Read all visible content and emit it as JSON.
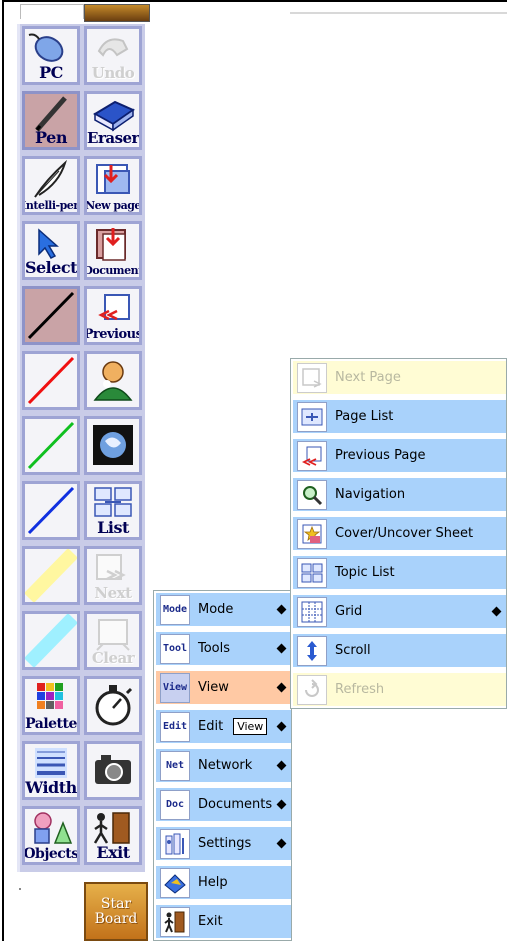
{
  "colors": {
    "toolbar_bg": "#c9cce8",
    "menu_item": "#a9d2fb",
    "menu_item_highlight": "#ffc9a4",
    "menu_item_disabled": "#fffcd4",
    "label_text": "#000054"
  },
  "toolbar": {
    "items": [
      {
        "label": "PC",
        "icon": "mouse-icon",
        "state": "normal"
      },
      {
        "label": "Undo",
        "icon": "undo-icon",
        "state": "disabled"
      },
      {
        "label": "Pen",
        "icon": "pen-icon",
        "state": "active"
      },
      {
        "label": "Eraser",
        "icon": "eraser-icon",
        "state": "normal"
      },
      {
        "label": "Intelli-pen",
        "icon": "quill-icon",
        "state": "normal"
      },
      {
        "label": "New page",
        "icon": "new-page-icon",
        "state": "normal"
      },
      {
        "label": "Select",
        "icon": "select-arrow-icon",
        "state": "normal"
      },
      {
        "label": "Document",
        "icon": "document-icon",
        "state": "normal"
      },
      {
        "label": "",
        "icon": "black-line-pen-icon",
        "state": "active"
      },
      {
        "label": "Previous",
        "icon": "previous-page-icon",
        "state": "normal"
      },
      {
        "label": "",
        "icon": "red-line-pen-icon",
        "state": "normal"
      },
      {
        "label": "",
        "icon": "user-icon",
        "state": "normal"
      },
      {
        "label": "",
        "icon": "green-line-pen-icon",
        "state": "normal"
      },
      {
        "label": "",
        "icon": "screen-capture-icon",
        "state": "normal"
      },
      {
        "label": "",
        "icon": "blue-line-pen-icon",
        "state": "normal"
      },
      {
        "label": "List",
        "icon": "list-icon",
        "state": "normal"
      },
      {
        "label": "",
        "icon": "yellow-highlighter-icon",
        "state": "normal"
      },
      {
        "label": "Next",
        "icon": "next-page-icon",
        "state": "disabled"
      },
      {
        "label": "",
        "icon": "cyan-highlighter-icon",
        "state": "normal"
      },
      {
        "label": "Clear",
        "icon": "clear-icon",
        "state": "disabled"
      },
      {
        "label": "Palette",
        "icon": "palette-icon",
        "state": "normal"
      },
      {
        "label": "",
        "icon": "stopwatch-icon",
        "state": "normal"
      },
      {
        "label": "Width",
        "icon": "width-icon",
        "state": "normal"
      },
      {
        "label": "",
        "icon": "camera-icon",
        "state": "normal"
      },
      {
        "label": "Objects",
        "icon": "objects-icon",
        "state": "normal"
      },
      {
        "label": "Exit",
        "icon": "exit-door-icon",
        "state": "normal"
      }
    ],
    "starboard": {
      "line1": "Star",
      "line2": "Board"
    }
  },
  "main_menu": {
    "items": [
      {
        "label": "Mode",
        "icon_text": "Mode",
        "submenu": true,
        "state": "normal"
      },
      {
        "label": "Tools",
        "icon_text": "Tool",
        "submenu": true,
        "state": "normal"
      },
      {
        "label": "View",
        "icon_text": "View",
        "submenu": true,
        "state": "highlighted"
      },
      {
        "label": "Edit",
        "icon_text": "Edit",
        "submenu": true,
        "state": "normal",
        "tooltip": "View"
      },
      {
        "label": "Network",
        "icon_text": "Net",
        "submenu": true,
        "state": "normal"
      },
      {
        "label": "Documents",
        "icon_text": "Doc",
        "submenu": true,
        "state": "normal"
      },
      {
        "label": "Settings",
        "icon": "settings-icon",
        "submenu": true,
        "state": "normal"
      },
      {
        "label": "Help",
        "icon": "help-icon",
        "submenu": false,
        "state": "normal"
      },
      {
        "label": "Exit",
        "icon": "exit-icon",
        "submenu": false,
        "state": "normal"
      }
    ]
  },
  "view_submenu": {
    "items": [
      {
        "label": "Next Page",
        "icon": "next-page-icon",
        "submenu": false,
        "state": "disabled"
      },
      {
        "label": "Page List",
        "icon": "page-list-icon",
        "submenu": false,
        "state": "normal"
      },
      {
        "label": "Previous Page",
        "icon": "previous-page-icon",
        "submenu": false,
        "state": "normal"
      },
      {
        "label": "Navigation",
        "icon": "magnifier-icon",
        "submenu": false,
        "state": "normal"
      },
      {
        "label": "Cover/Uncover Sheet",
        "icon": "cover-sheet-icon",
        "submenu": false,
        "state": "normal"
      },
      {
        "label": "Topic List",
        "icon": "topic-list-icon",
        "submenu": false,
        "state": "normal"
      },
      {
        "label": "Grid",
        "icon": "grid-icon",
        "submenu": true,
        "state": "normal"
      },
      {
        "label": "Scroll",
        "icon": "scroll-icon",
        "submenu": false,
        "state": "normal"
      },
      {
        "label": "Refresh",
        "icon": "refresh-icon",
        "submenu": false,
        "state": "disabled"
      }
    ]
  }
}
